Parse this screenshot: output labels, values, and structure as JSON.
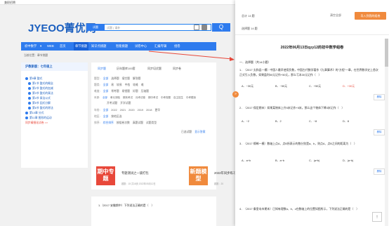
{
  "topnav": {
    "label": "兼职招聘"
  },
  "site": {
    "logo": "JYEOO菁优网"
  },
  "search": {
    "select": "试题",
    "placeholder": "试题 | 请补",
    "button": "Q"
  },
  "nav": {
    "items": [
      "初中数学",
      "▾",
      "WEB",
      "首页",
      "章节挑题",
      "知识点挑题",
      "智能挑题",
      "试卷中心",
      "汇编专辑",
      "组卷"
    ]
  },
  "breadcrumb": "当前位置：章节挑题",
  "sidebar": {
    "title": "沪教新版：七年级上",
    "items": [
      "第9章 整式",
      "第1节 整式的概念",
      "第2节 整式的加减",
      "第3节 整式的乘法",
      "第4节 乘法公式",
      "第5节 因式分解",
      "第6节 整式的除法",
      "第10章 分式",
      "第11章 图形的运动",
      "同步精细化试卷 >>"
    ]
  },
  "main": {
    "tabs": [
      "同步题",
      "历年题库100套",
      "同步培优题",
      "同步卷"
    ],
    "filters": [
      {
        "label": "题型:",
        "options": [
          "全部",
          "选择题",
          "填空题",
          "解答题"
        ]
      },
      {
        "label": "题类:",
        "options": [
          "全部",
          "易",
          "较易",
          "中档",
          "较难",
          "难"
        ]
      },
      {
        "label": "难度:",
        "options": [
          "全部",
          "常考题",
          "易错题",
          "好题",
          "压轴题"
        ]
      },
      {
        "label": "来源:",
        "options": [
          "全部",
          "单元测验",
          "期末考试",
          "月考试卷",
          "期中考试",
          "中考真题",
          "自主招生",
          "中考模拟"
        ]
      },
      {
        "label": "",
        "options": [
          "开考试题",
          "开学试题"
        ]
      },
      {
        "label": "年份:",
        "options": [
          "全部",
          "2022",
          "2021",
          "2020",
          "2019",
          "2018",
          "更早"
        ]
      },
      {
        "label": "地区:",
        "options": [
          "全部",
          "按地区选"
        ]
      },
      {
        "label": "排序:",
        "options": [
          "综合排序",
          "按组卷次数",
          "真题试题",
          "试题类型"
        ]
      }
    ],
    "checkbox_label": "已选试题",
    "display_label": "显示答案",
    "cards": [
      {
        "thumb": "期中专题",
        "title": "专题测试之一铺打包",
        "meta": "题数：15  共18页 2022年05月12日"
      },
      {
        "thumb": "新题模型",
        "title": "2022年同步练习题",
        "meta": "题数：20"
      }
    ],
    "question_preview": "1.（2017·安徽期中）下列说法正确的是（　）"
  },
  "panel": {
    "total_label": "总计 14 题",
    "selected_label": "选择题 14 题",
    "clear_label": "清空全部",
    "export_label": "导入到我的组卷",
    "paper_title": "2022年06月13日qyy12的初中数学组卷",
    "section": "一．选择题（共14小题）",
    "questions": [
      {
        "text": "1．（2017·太和县一模）中国人最早使用负数，中国古代数学著作《九章算术》的\"方程\"一章，在世界数学史上首次正式引入负数，如果盈利50元记作+50元，那么亏本30元记作（　）",
        "options": [
          "A．−30元",
          "B．−50元",
          "C．+50元",
          "D．+30元"
        ]
      },
      {
        "text": "2．（2017·保定期末）如果某物体上升5米记作+5米，那么这个物体下降3米记作（　）",
        "options": [
          "A．−2",
          "B．2",
          "C．−8",
          "D．8"
        ]
      },
      {
        "text": "3．（2017·邯郸一模）数轴上点A、点B所表示的数分别是a、b，则点A、点B之间的距离为（　）",
        "options": [
          "A．a+b",
          "B．a−b",
          "C．|a+b|",
          "D．|a−b|"
        ]
      },
      {
        "text": "4．（2017·秦皇岛市期末）已知有理数a、b、c在数轴上的位置如图所示，下列说法正确的是（　）",
        "options": []
      }
    ],
    "delete_label": "删除",
    "toggle_icon": "»",
    "to_top_icon": "↑"
  }
}
